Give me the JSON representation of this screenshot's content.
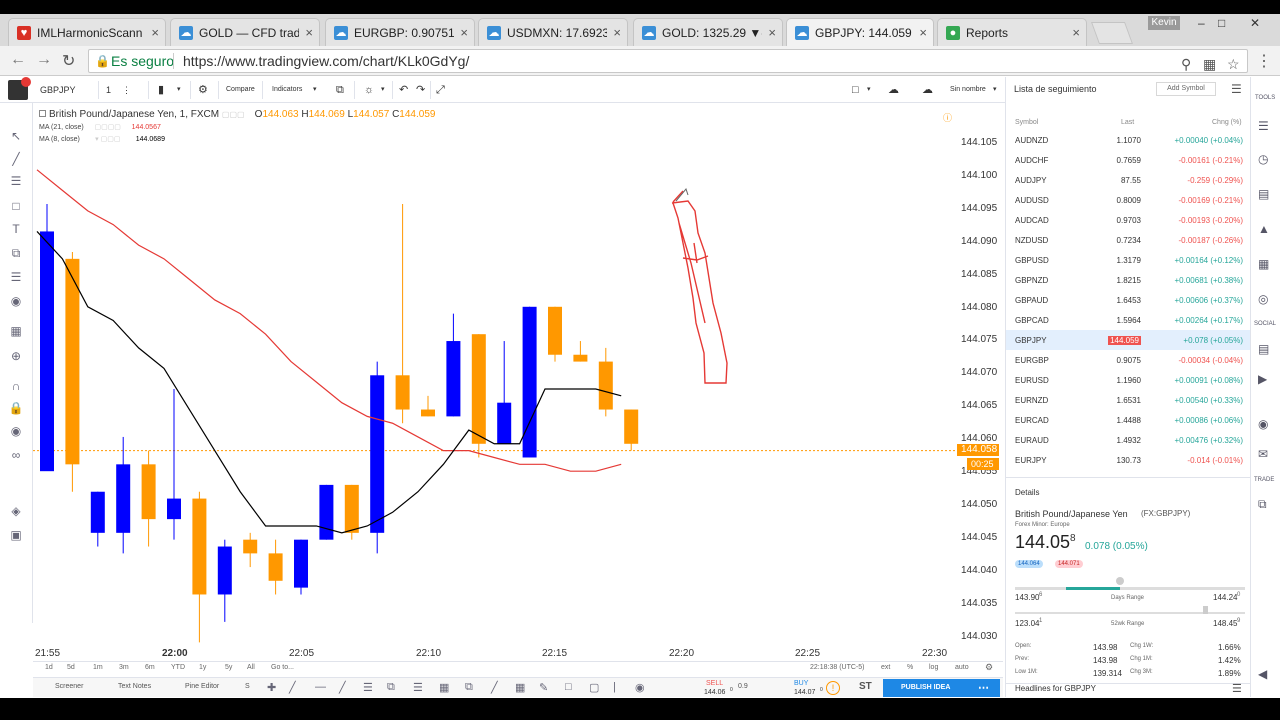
{
  "browser": {
    "tabs": [
      {
        "title": "IMLHarmonicScann",
        "color": "#d93025",
        "icon": "heart-icon"
      },
      {
        "title": "GOLD — CFD tradi",
        "color": "#3b8fd6",
        "icon": "cloud-icon"
      },
      {
        "title": "EURGBP: 0.90751 ▼",
        "color": "#3b8fd6",
        "icon": "cloud-icon"
      },
      {
        "title": "USDMXN: 17.6923",
        "color": "#3b8fd6",
        "icon": "cloud-icon"
      },
      {
        "title": "GOLD: 1325.29 ▼-",
        "color": "#3b8fd6",
        "icon": "cloud-icon"
      },
      {
        "title": "GBPJPY: 144.059 ▲",
        "color": "#3b8fd6",
        "icon": "cloud-icon",
        "active": true
      },
      {
        "title": "Reports",
        "color": "#34a853",
        "icon": "reports-icon"
      }
    ],
    "user": "Kevin",
    "security_label": "Es seguro",
    "url": "https://www.tradingview.com/chart/KLk0GdYg/"
  },
  "toolbar": {
    "symbol": "GBPJPY",
    "interval": "1",
    "compare": "Compare",
    "indicators": "Indicators",
    "layout_name": "Sin nombre"
  },
  "legend": {
    "title": "British Pound/Japanese Yen, 1, FXCM",
    "o_label": "O",
    "o": "144.063",
    "h_label": "H",
    "h": "144.069",
    "l_label": "L",
    "l": "144.057",
    "c_label": "C",
    "c": "144.059",
    "ma1": "MA (21, close)",
    "ma1_val": "144.0567",
    "ma2": "MA (8, close)",
    "ma2_val": "144.0689"
  },
  "price_axis": {
    "labels": [
      "144.105",
      "144.100",
      "144.095",
      "144.090",
      "144.085",
      "144.080",
      "144.075",
      "144.070",
      "144.065",
      "144.060",
      "144.055",
      "144.050",
      "144.045",
      "144.040",
      "144.035",
      "144.030"
    ],
    "current_price": "144.058",
    "countdown": "00:25"
  },
  "time_axis": {
    "labels": [
      "21:55",
      "22:00",
      "22:05",
      "22:10",
      "22:15",
      "22:20",
      "22:25",
      "22:30"
    ],
    "clock": "22:18:38 (UTC-5)",
    "opts": [
      "ext",
      "%",
      "log",
      "auto"
    ]
  },
  "ranges": [
    "1d",
    "5d",
    "1m",
    "3m",
    "6m",
    "YTD",
    "1y",
    "5y",
    "All",
    "Go to..."
  ],
  "bottom_tabs": [
    "Screener",
    "Text Notes",
    "Pine Editor",
    "S"
  ],
  "trade": {
    "sell": "SELL",
    "sell_price": "144.06",
    "sell_sup": "0",
    "spread": "0.9",
    "buy": "BUY",
    "buy_price": "144.07",
    "buy_sup": "0",
    "st": "ST",
    "publish": "PUBLISH IDEA"
  },
  "watchlist": {
    "title": "Lista de seguimiento",
    "add_symbol": "Add Symbol",
    "col_symbol": "Symbol",
    "col_last": "Last",
    "col_chg": "Chng (%)",
    "rows": [
      {
        "s": "AUDNZD",
        "l": "1.1070",
        "c": "+0.00040 (+0.04%)",
        "d": "pos"
      },
      {
        "s": "AUDCHF",
        "l": "0.7659",
        "c": "-0.00161 (-0.21%)",
        "d": "neg"
      },
      {
        "s": "AUDJPY",
        "l": "87.55",
        "c": "-0.259 (-0.29%)",
        "d": "neg"
      },
      {
        "s": "AUDUSD",
        "l": "0.8009",
        "c": "-0.00169 (-0.21%)",
        "d": "neg"
      },
      {
        "s": "AUDCAD",
        "l": "0.9703",
        "c": "-0.00193 (-0.20%)",
        "d": "neg"
      },
      {
        "s": "NZDUSD",
        "l": "0.7234",
        "c": "-0.00187 (-0.26%)",
        "d": "neg"
      },
      {
        "s": "GBPUSD",
        "l": "1.3179",
        "c": "+0.00164 (+0.12%)",
        "d": "pos"
      },
      {
        "s": "GBPNZD",
        "l": "1.8215",
        "c": "+0.00681 (+0.38%)",
        "d": "pos"
      },
      {
        "s": "GBPAUD",
        "l": "1.6453",
        "c": "+0.00606 (+0.37%)",
        "d": "pos"
      },
      {
        "s": "GBPCAD",
        "l": "1.5964",
        "c": "+0.00264 (+0.17%)",
        "d": "pos"
      },
      {
        "s": "GBPJPY",
        "l": "144.059",
        "c": "+0.078 (+0.05%)",
        "d": "pos",
        "sel": true
      },
      {
        "s": "EURGBP",
        "l": "0.9075",
        "c": "-0.00034 (-0.04%)",
        "d": "neg"
      },
      {
        "s": "EURUSD",
        "l": "1.1960",
        "c": "+0.00091 (+0.08%)",
        "d": "pos"
      },
      {
        "s": "EURNZD",
        "l": "1.6531",
        "c": "+0.00540 (+0.33%)",
        "d": "pos"
      },
      {
        "s": "EURCAD",
        "l": "1.4488",
        "c": "+0.00086 (+0.06%)",
        "d": "pos"
      },
      {
        "s": "EURAUD",
        "l": "1.4932",
        "c": "+0.00476 (+0.32%)",
        "d": "pos"
      },
      {
        "s": "EURJPY",
        "l": "130.73",
        "c": "-0.014 (-0.01%)",
        "d": "neg"
      }
    ]
  },
  "details": {
    "header": "Details",
    "name": "British Pound/Japanese Yen",
    "code": "(FX:GBPJPY)",
    "market": "Forex Minor: Europe",
    "price_main": "144.05",
    "price_sup": "8",
    "change": "0.078 (0.05%)",
    "bid": "144.064",
    "ask": "144.071",
    "days_low": "143.90",
    "days_low_sup": "6",
    "days_label": "Days Range",
    "days_high": "144.24",
    "days_high_sup": "0",
    "wk_low": "123.04",
    "wk_low_sup": "1",
    "wk_label": "52wk Range",
    "wk_high": "148.45",
    "wk_high_sup": "9",
    "stats": [
      {
        "k": "Open:",
        "v": "143.98",
        "k2": "Chg 1W:",
        "v2": "1.66%"
      },
      {
        "k": "Prev:",
        "v": "143.98",
        "k2": "Chg 1M:",
        "v2": "1.42%"
      },
      {
        "k": "Low 1M:",
        "v": "139.314",
        "k2": "Chg 3M:",
        "v2": "1.89%"
      }
    ],
    "headlines": "Headlines for GBPJPY"
  },
  "colors": {
    "up": "#0000ff",
    "down": "#ff9800",
    "ma21": "#e53935",
    "ma8": "#000000",
    "price": "#ff9800"
  },
  "right_tools": [
    "TOOLS",
    "SOCIAL",
    "TRADE"
  ],
  "chart_data": {
    "type": "candlestick",
    "interval": "1 min",
    "ylim": [
      144.028,
      144.107
    ],
    "x_labels": [
      "21:55",
      "22:00",
      "22:05",
      "22:10",
      "22:15",
      "22:20",
      "22:25",
      "22:30"
    ],
    "candles": [
      {
        "o": 144.055,
        "h": 144.094,
        "l": 144.059,
        "c": 144.09
      },
      {
        "o": 144.086,
        "h": 144.087,
        "l": 144.052,
        "c": 144.056
      },
      {
        "o": 144.046,
        "h": 144.052,
        "l": 144.044,
        "c": 144.052
      },
      {
        "o": 144.046,
        "h": 144.06,
        "l": 144.043,
        "c": 144.056
      },
      {
        "o": 144.056,
        "h": 144.058,
        "l": 144.044,
        "c": 144.048
      },
      {
        "o": 144.048,
        "h": 144.067,
        "l": 144.045,
        "c": 144.051
      },
      {
        "o": 144.051,
        "h": 144.052,
        "l": 144.03,
        "c": 144.037
      },
      {
        "o": 144.037,
        "h": 144.045,
        "l": 144.033,
        "c": 144.044
      },
      {
        "o": 144.045,
        "h": 144.046,
        "l": 144.041,
        "c": 144.043
      },
      {
        "o": 144.043,
        "h": 144.045,
        "l": 144.037,
        "c": 144.039
      },
      {
        "o": 144.038,
        "h": 144.045,
        "l": 144.037,
        "c": 144.045
      },
      {
        "o": 144.045,
        "h": 144.053,
        "l": 144.045,
        "c": 144.053
      },
      {
        "o": 144.053,
        "h": 144.053,
        "l": 144.045,
        "c": 144.046
      },
      {
        "o": 144.046,
        "h": 144.071,
        "l": 144.043,
        "c": 144.069
      },
      {
        "o": 144.069,
        "h": 144.094,
        "l": 144.062,
        "c": 144.064
      },
      {
        "o": 144.064,
        "h": 144.066,
        "l": 144.063,
        "c": 144.063
      },
      {
        "o": 144.063,
        "h": 144.078,
        "l": 144.063,
        "c": 144.074
      },
      {
        "o": 144.075,
        "h": 144.075,
        "l": 144.057,
        "c": 144.059
      },
      {
        "o": 144.059,
        "h": 144.074,
        "l": 144.059,
        "c": 144.065
      },
      {
        "o": 144.057,
        "h": 144.079,
        "l": 144.057,
        "c": 144.079
      },
      {
        "o": 144.079,
        "h": 144.079,
        "l": 144.071,
        "c": 144.072
      },
      {
        "o": 144.072,
        "h": 144.074,
        "l": 144.071,
        "c": 144.071
      },
      {
        "o": 144.071,
        "h": 144.073,
        "l": 144.063,
        "c": 144.064
      },
      {
        "o": 144.064,
        "h": 144.064,
        "l": 144.058,
        "c": 144.059
      }
    ],
    "ma21": [
      144.099,
      144.096,
      144.093,
      144.091,
      144.088,
      144.086,
      144.083,
      144.08,
      144.078,
      144.075,
      144.071,
      144.068,
      144.065,
      144.063,
      144.062,
      144.06,
      144.058,
      144.058,
      144.057,
      144.056,
      144.056,
      144.055,
      144.055,
      144.056
    ],
    "ma8": [
      144.09,
      144.086,
      144.079,
      144.077,
      144.073,
      144.07,
      144.064,
      144.058,
      144.052,
      144.047,
      144.047,
      144.047,
      144.046,
      144.047,
      144.049,
      144.052,
      144.056,
      144.061,
      144.059,
      144.059,
      144.067,
      144.067,
      144.067,
      144.066
    ],
    "current_price": 144.058
  }
}
